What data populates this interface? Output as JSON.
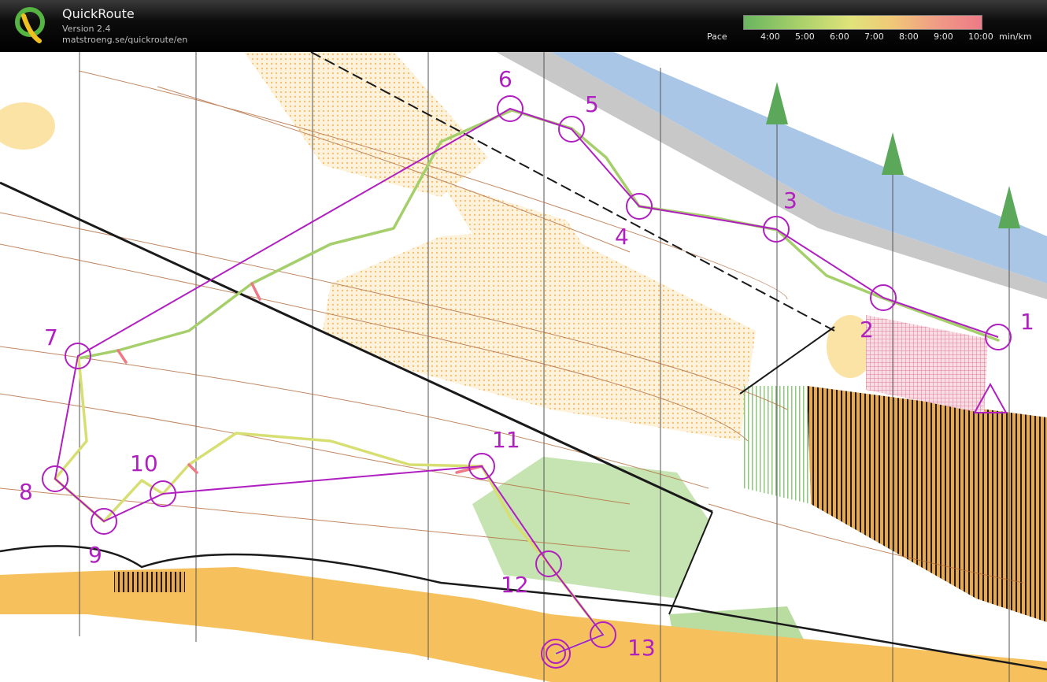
{
  "app": {
    "name": "QuickRoute",
    "version": "Version 2.4",
    "url": "matstroeng.se/quickroute/en"
  },
  "legend": {
    "label": "Pace",
    "ticks": [
      "4:00",
      "5:00",
      "6:00",
      "7:00",
      "8:00",
      "9:00",
      "10:00"
    ],
    "unit": "min/km",
    "colors": {
      "fast": "#6ab55f",
      "mid": "#e0e37a",
      "slow": "#ee7a86"
    }
  },
  "course": {
    "color": "#b01fc0",
    "controls": [
      "1",
      "2",
      "3",
      "4",
      "5",
      "6",
      "7",
      "8",
      "9",
      "10",
      "11",
      "12",
      "13"
    ]
  },
  "map_colors": {
    "open": "#f6c15d",
    "rough": "#fbe3a6",
    "forest": "#b9dca0",
    "water": "#a9c6e6",
    "contour": "#b36a3b",
    "road": "#1a1a1a"
  }
}
